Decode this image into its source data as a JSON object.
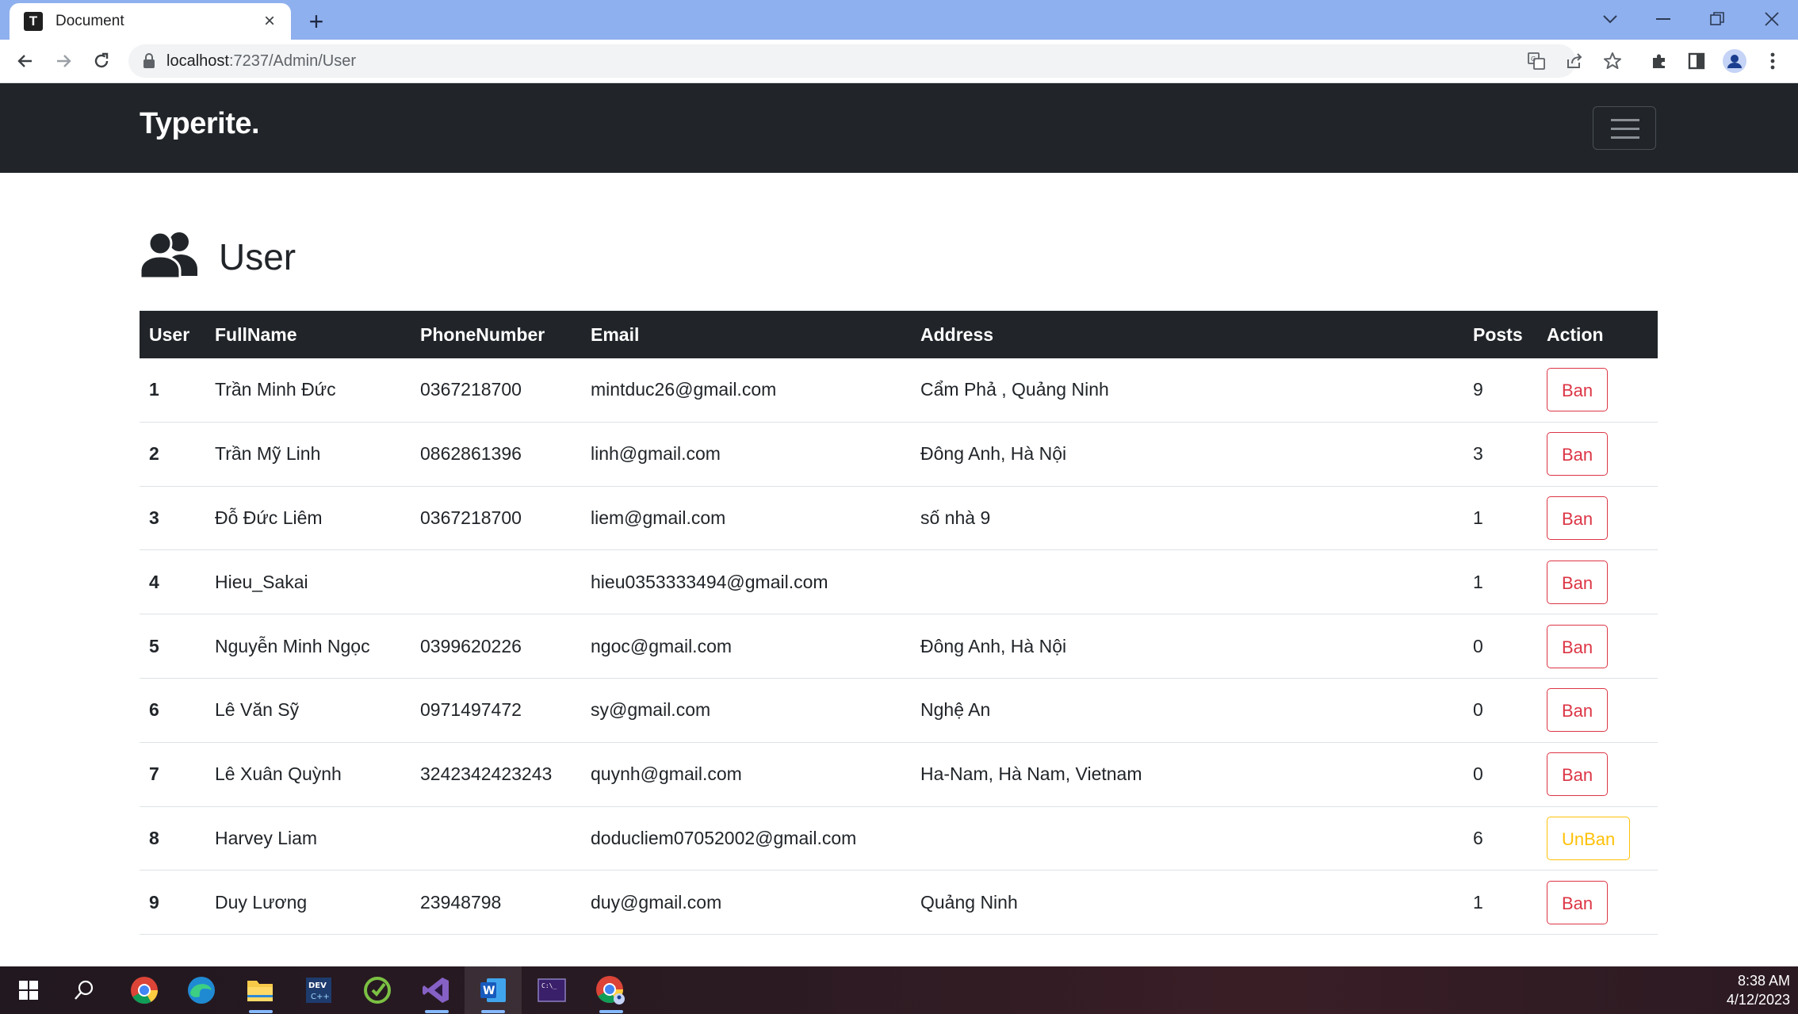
{
  "browser": {
    "tab_title": "Document",
    "tab_favicon": "T",
    "url_host": "localhost",
    "url_rest": ":7237/Admin/User"
  },
  "navbar": {
    "brand": "Typerite."
  },
  "page": {
    "title": "User"
  },
  "table": {
    "headers": [
      "User",
      "FullName",
      "PhoneNumber",
      "Email",
      "Address",
      "Posts",
      "Action"
    ],
    "rows": [
      {
        "id": "1",
        "fullname": "Trần Minh Đức",
        "phone": "0367218700",
        "email": "mintduc26@gmail.com",
        "address": "Cẩm Phả , Quảng Ninh",
        "posts": "9",
        "action": "Ban",
        "action_type": "ban"
      },
      {
        "id": "2",
        "fullname": "Trần Mỹ Linh",
        "phone": "0862861396",
        "email": "linh@gmail.com",
        "address": "Đông Anh, Hà Nội",
        "posts": "3",
        "action": "Ban",
        "action_type": "ban"
      },
      {
        "id": "3",
        "fullname": "Đỗ Đức Liêm",
        "phone": "0367218700",
        "email": "liem@gmail.com",
        "address": "số nhà 9",
        "posts": "1",
        "action": "Ban",
        "action_type": "ban"
      },
      {
        "id": "4",
        "fullname": "Hieu_Sakai",
        "phone": "",
        "email": "hieu0353333494@gmail.com",
        "address": "",
        "posts": "1",
        "action": "Ban",
        "action_type": "ban"
      },
      {
        "id": "5",
        "fullname": "Nguyễn Minh Ngọc",
        "phone": "0399620226",
        "email": "ngoc@gmail.com",
        "address": "Đông Anh, Hà Nội",
        "posts": "0",
        "action": "Ban",
        "action_type": "ban"
      },
      {
        "id": "6",
        "fullname": "Lê Văn Sỹ",
        "phone": "0971497472",
        "email": "sy@gmail.com",
        "address": "Nghệ An",
        "posts": "0",
        "action": "Ban",
        "action_type": "ban"
      },
      {
        "id": "7",
        "fullname": "Lê Xuân Quỳnh",
        "phone": "3242342423243",
        "email": "quynh@gmail.com",
        "address": "Ha-Nam, Hà Nam, Vietnam",
        "posts": "0",
        "action": "Ban",
        "action_type": "ban"
      },
      {
        "id": "8",
        "fullname": "Harvey Liam",
        "phone": "",
        "email": "doducliem07052002@gmail.com",
        "address": "",
        "posts": "6",
        "action": "UnBan",
        "action_type": "unban"
      },
      {
        "id": "9",
        "fullname": "Duy Lương",
        "phone": "23948798",
        "email": "duy@gmail.com",
        "address": "Quảng Ninh",
        "posts": "1",
        "action": "Ban",
        "action_type": "ban"
      }
    ]
  },
  "taskbar": {
    "time": "8:38 AM",
    "date": "4/12/2023",
    "apps": [
      "start-icon",
      "search-icon",
      "chrome-icon",
      "edge-icon",
      "file-explorer-icon",
      "dev-cpp-icon",
      "app-green-icon",
      "visual-studio-icon",
      "word-icon",
      "terminal-icon",
      "chrome-profile-icon"
    ]
  },
  "colors": {
    "navbar_bg": "#212529",
    "tab_strip": "#8fb0ee",
    "ban": "#dc3545",
    "unban": "#ffc107"
  }
}
